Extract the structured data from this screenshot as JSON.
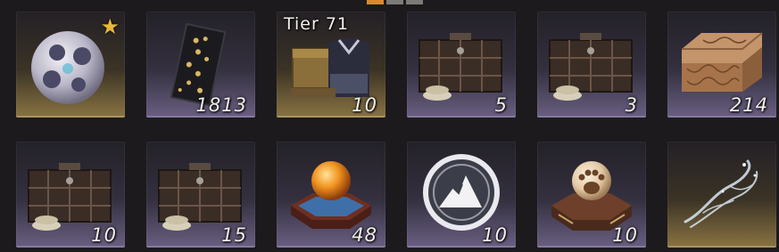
{
  "pager": [
    "active",
    "",
    ""
  ],
  "colors": {
    "accent": "#d88a2c",
    "qty_text": "#f1efe9",
    "favorite_star": "#e8b83a"
  },
  "inventory": {
    "slots": [
      {
        "name": "moon-orb",
        "rarity": "gold",
        "icon": "moon-orb-icon",
        "quantity": "",
        "favorite": "★"
      },
      {
        "name": "fragment-scroll",
        "rarity": "purple",
        "icon": "fragment-scroll-icon",
        "quantity": "1813"
      },
      {
        "name": "armor-chest",
        "rarity": "gold",
        "icon": "armor-chest-icon",
        "quantity": "10",
        "tier": "Tier 71"
      },
      {
        "name": "supply-crate-1",
        "rarity": "purple",
        "icon": "supply-crate-icon",
        "quantity": "5"
      },
      {
        "name": "supply-crate-2",
        "rarity": "purple",
        "icon": "supply-crate-icon",
        "quantity": "3"
      },
      {
        "name": "ornate-chest",
        "rarity": "purple",
        "icon": "ornate-chest-icon",
        "quantity": "214"
      },
      {
        "name": "supply-crate-3",
        "rarity": "purple",
        "icon": "supply-crate-icon",
        "quantity": "10"
      },
      {
        "name": "supply-crate-4",
        "rarity": "purple",
        "icon": "supply-crate-icon",
        "quantity": "15"
      },
      {
        "name": "fire-orb-pedestal",
        "rarity": "purple",
        "icon": "fire-orb-pedestal-icon",
        "quantity": "48"
      },
      {
        "name": "mountain-token",
        "rarity": "purple",
        "icon": "mountain-token-icon",
        "quantity": "10"
      },
      {
        "name": "paw-orb-pedestal",
        "rarity": "purple",
        "icon": "paw-orb-pedestal-icon",
        "quantity": "10"
      },
      {
        "name": "spirit-wisp",
        "rarity": "gold",
        "icon": "spirit-wisp-icon",
        "quantity": ""
      }
    ]
  }
}
